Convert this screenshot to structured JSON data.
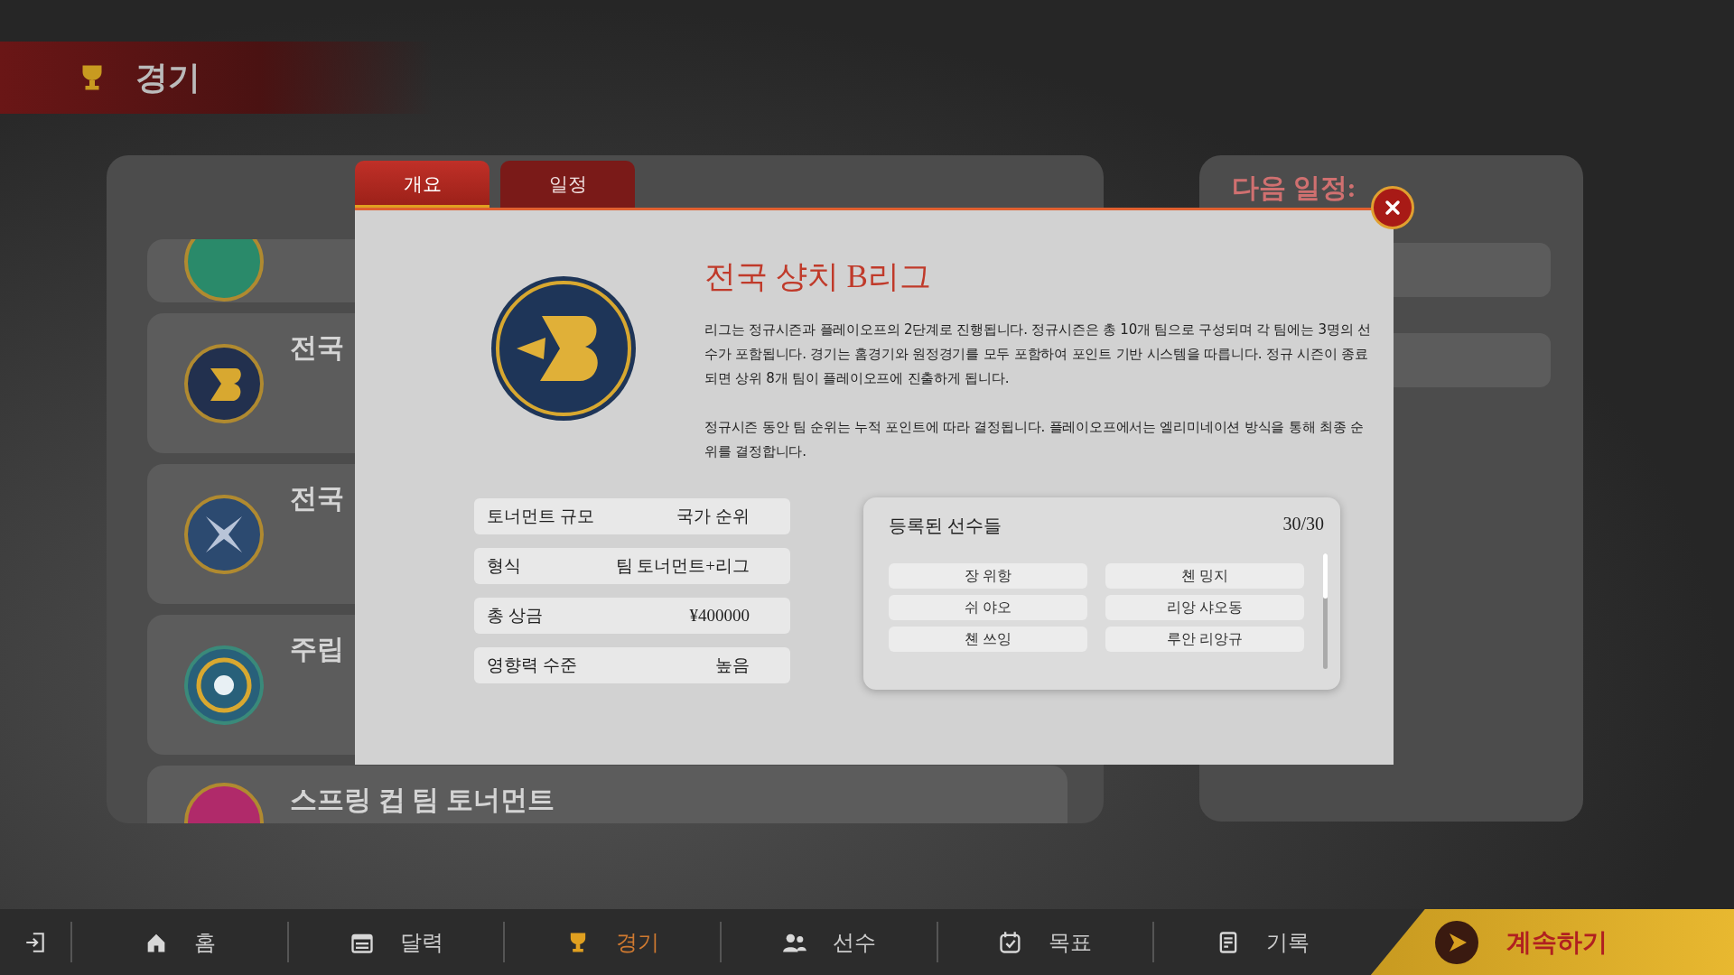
{
  "header": {
    "title": "경기"
  },
  "background": {
    "tournaments": [
      {
        "name": "전국"
      },
      {
        "name": "전국"
      },
      {
        "name": "주립"
      },
      {
        "name": "스프링 컵 팀 토너먼트"
      }
    ],
    "schedule": {
      "title": "다음 일정:"
    }
  },
  "dialog": {
    "tabs": [
      {
        "label": "개요",
        "selected": true
      },
      {
        "label": "일정",
        "selected": false
      }
    ],
    "title": "전국 샹치 B리그",
    "paragraphs": [
      "리그는 정규시즌과 플레이오프의 2단계로 진행됩니다. 정규시즌은 총 10개 팀으로 구성되며 각 팀에는 3명의 선수가 포함됩니다. 경기는 홈경기와 원정경기를 모두 포함하여 포인트 기반 시스템을 따릅니다. 정규 시즌이 종료되면 상위 8개 팀이 플레이오프에 진출하게 됩니다.",
      "정규시즌 동안 팀 순위는 누적 포인트에 따라 결정됩니다. 플레이오프에서는 엘리미네이션 방식을 통해 최종 순위를 결정합니다."
    ],
    "info": [
      {
        "label": "토너먼트 규모",
        "value": "국가 순위"
      },
      {
        "label": "형식",
        "value": "팀 토너먼트+리그"
      },
      {
        "label": "총 상금",
        "value": "¥400000"
      },
      {
        "label": "영향력 수준",
        "value": "높음"
      }
    ],
    "players": {
      "title": "등록된 선수들",
      "count": "30/30",
      "names": [
        "장 위항",
        "쳰 밍지",
        "쉬 야오",
        "리앙 샤오동",
        "쳰 쓰잉",
        "루안 리앙규"
      ]
    }
  },
  "nav": {
    "items": [
      {
        "label": "홈",
        "selected": false
      },
      {
        "label": "달력",
        "selected": false
      },
      {
        "label": "경기",
        "selected": true
      },
      {
        "label": "선수",
        "selected": false
      },
      {
        "label": "목표",
        "selected": false
      },
      {
        "label": "기록",
        "selected": false
      }
    ],
    "continue": {
      "label": "계속하기"
    }
  }
}
